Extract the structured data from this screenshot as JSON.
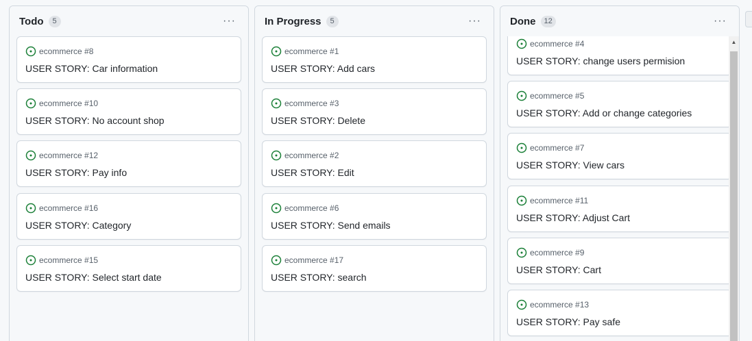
{
  "columns": [
    {
      "title": "Todo",
      "count": "5",
      "menu": "···",
      "cards": [
        {
          "ref": "ecommerce #8",
          "title": "USER STORY: Car information"
        },
        {
          "ref": "ecommerce #10",
          "title": "USER STORY: No account shop"
        },
        {
          "ref": "ecommerce #12",
          "title": "USER STORY: Pay info"
        },
        {
          "ref": "ecommerce #16",
          "title": "USER STORY: Category"
        },
        {
          "ref": "ecommerce #15",
          "title": "USER STORY: Select start date"
        }
      ]
    },
    {
      "title": "In Progress",
      "count": "5",
      "menu": "···",
      "cards": [
        {
          "ref": "ecommerce #1",
          "title": "USER STORY: Add cars"
        },
        {
          "ref": "ecommerce #3",
          "title": "USER STORY: Delete"
        },
        {
          "ref": "ecommerce #2",
          "title": "USER STORY: Edit"
        },
        {
          "ref": "ecommerce #6",
          "title": "USER STORY: Send emails"
        },
        {
          "ref": "ecommerce #17",
          "title": "USER STORY: search"
        }
      ]
    },
    {
      "title": "Done",
      "count": "12",
      "menu": "···",
      "cards": [
        {
          "ref": "ecommerce #4",
          "title": "USER STORY: change users permision"
        },
        {
          "ref": "ecommerce #5",
          "title": "USER STORY: Add or change categories"
        },
        {
          "ref": "ecommerce #7",
          "title": "USER STORY: View cars"
        },
        {
          "ref": "ecommerce #11",
          "title": "USER STORY: Adjust Cart"
        },
        {
          "ref": "ecommerce #9",
          "title": "USER STORY: Cart"
        },
        {
          "ref": "ecommerce #13",
          "title": "USER STORY: Pay safe"
        }
      ]
    }
  ],
  "scroll_up_glyph": "▲",
  "issue_icon": "issue-opened-icon",
  "colors": {
    "issue_open": "#1a7f37",
    "card_border": "#d0d7de",
    "background": "#f6f8fa"
  }
}
